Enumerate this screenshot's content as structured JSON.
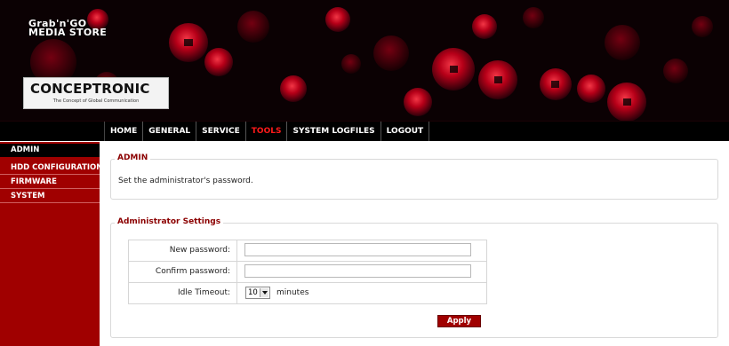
{
  "brand": {
    "store_line1": "Grab'n'GO",
    "store_line2": "MEDIA STORE",
    "logo_name": "CONCEPTRONIC",
    "logo_tagline": "The Concept of Global Communication"
  },
  "nav": {
    "items": [
      {
        "label": "HOME"
      },
      {
        "label": "GENERAL"
      },
      {
        "label": "SERVICE"
      },
      {
        "label": "TOOLS",
        "active": true
      },
      {
        "label": "SYSTEM LOGFILES"
      },
      {
        "label": "LOGOUT"
      }
    ]
  },
  "sidebar": {
    "items": [
      {
        "label": "ADMIN",
        "active": true
      },
      {
        "label": "HDD CONFIGURATION"
      },
      {
        "label": "FIRMWARE"
      },
      {
        "label": "SYSTEM"
      }
    ]
  },
  "admin_panel": {
    "title": "ADMIN",
    "description": "Set the administrator's password."
  },
  "settings_panel": {
    "title": "Administrator Settings",
    "new_password_label": "New password:",
    "new_password_value": "",
    "confirm_password_label": "Confirm password:",
    "confirm_password_value": "",
    "idle_timeout_label": "Idle Timeout:",
    "idle_timeout_value": "10",
    "idle_timeout_unit": "minutes",
    "apply_label": "Apply"
  },
  "colors": {
    "accent_red": "#a00000",
    "nav_active": "#ff1a1a",
    "legend_text": "#8b0000"
  }
}
